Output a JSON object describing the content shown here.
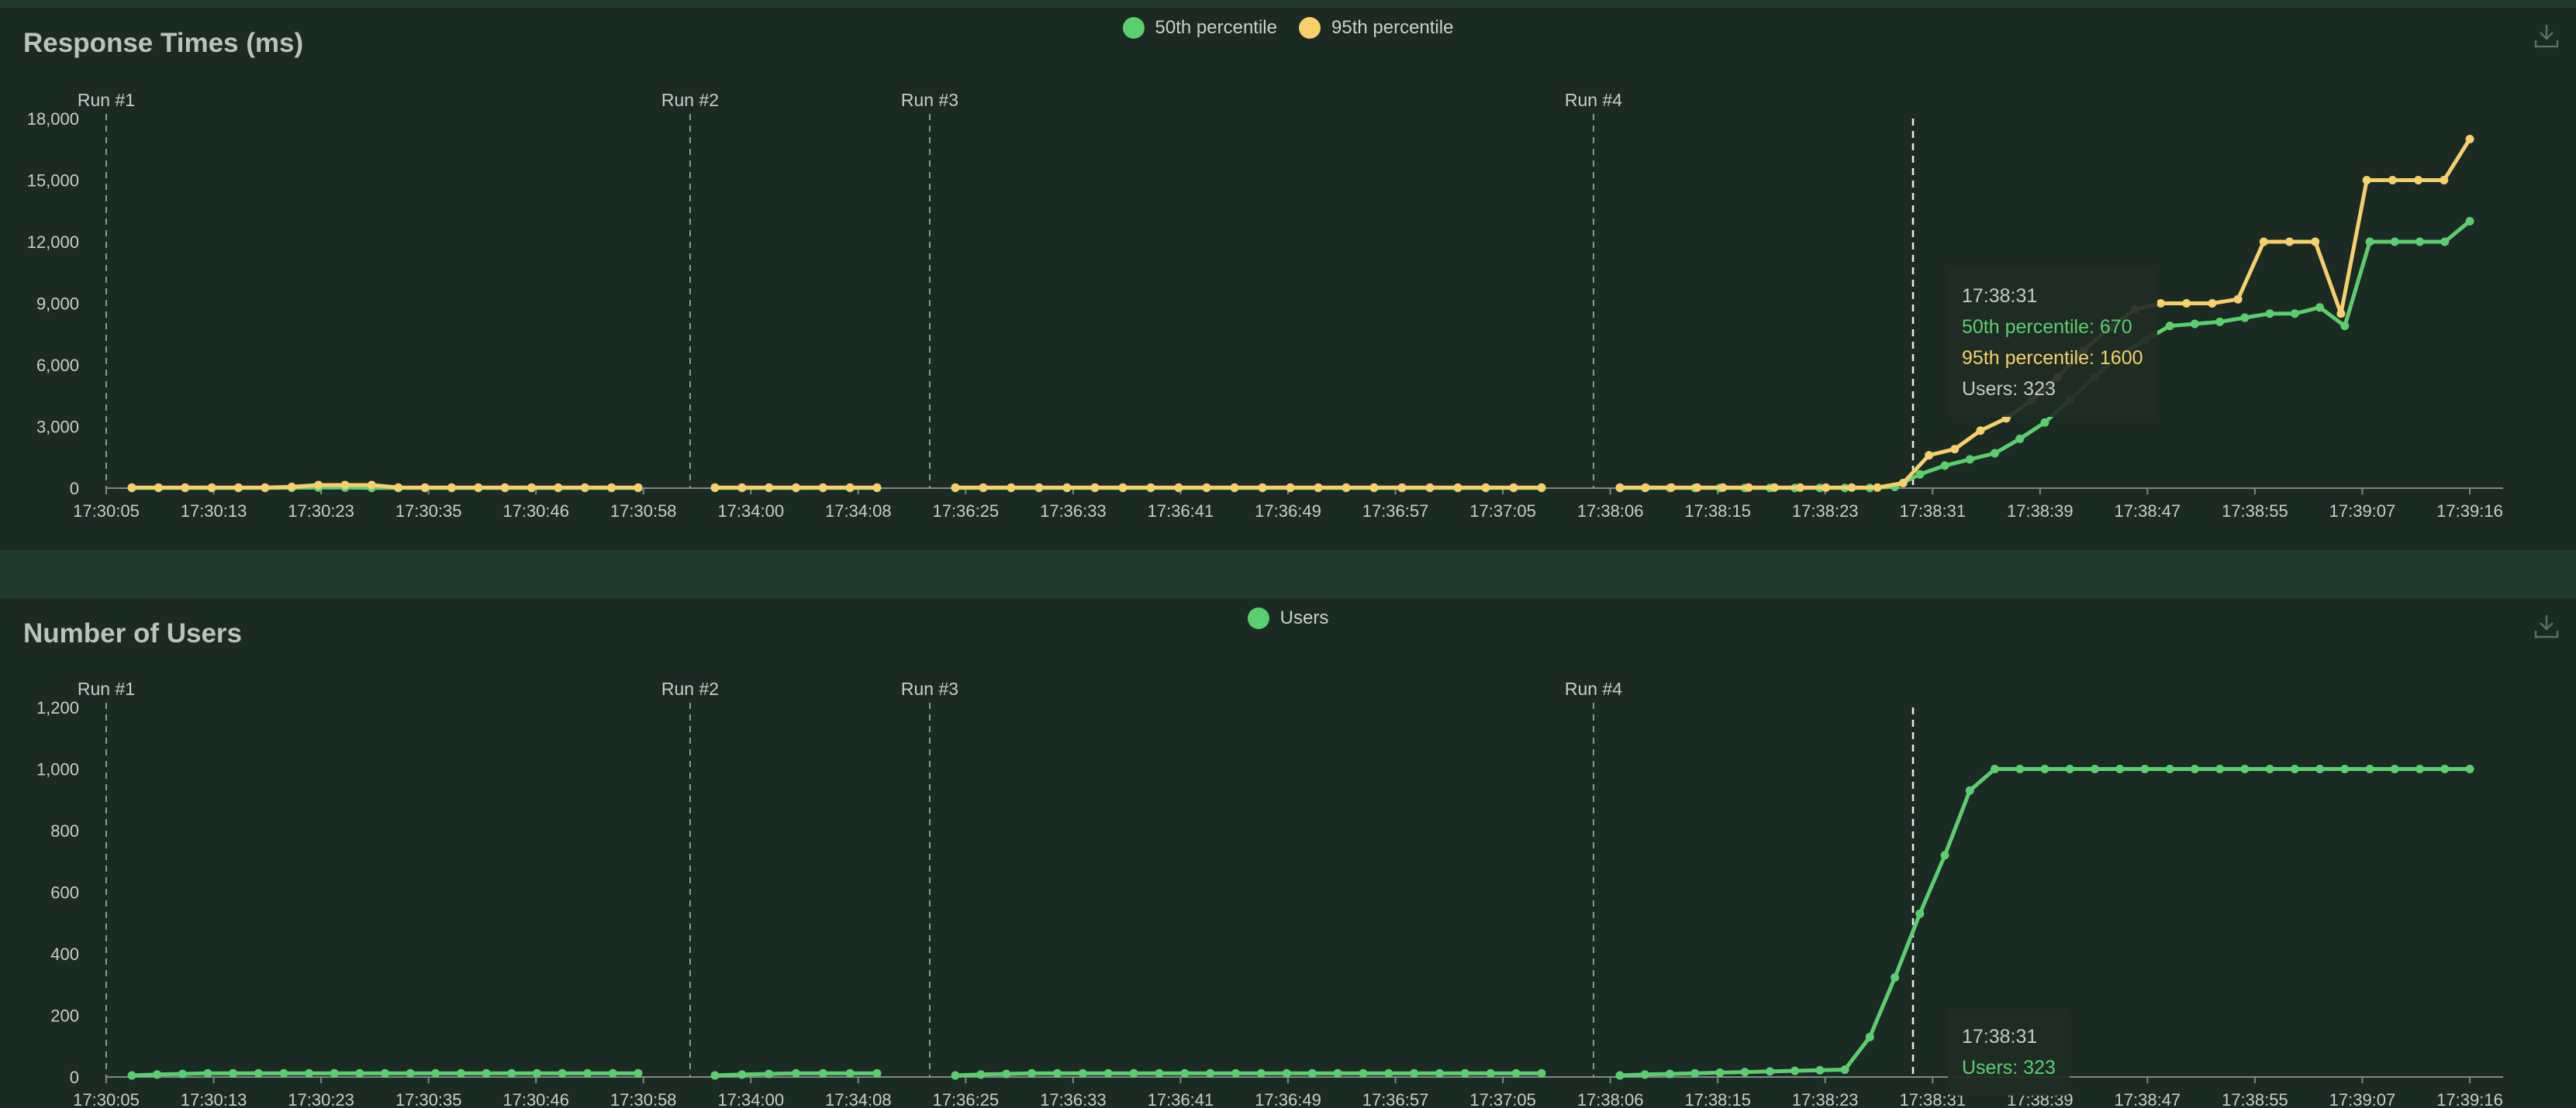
{
  "colors": {
    "p50": "#5bcf6e",
    "p95": "#f7cf6b",
    "users": "#5bcf6e",
    "axis_text": "#c6cec8",
    "divider": "#8b9a90"
  },
  "icons": {
    "download": "download-icon"
  },
  "chart_data": [
    {
      "type": "line",
      "title": "Response Times (ms)",
      "ylim": [
        0,
        18000
      ],
      "yticks": [
        "0",
        "3,000",
        "6,000",
        "9,000",
        "12,000",
        "15,000",
        "18,000"
      ],
      "ytick_values": [
        0,
        3000,
        6000,
        9000,
        12000,
        15000,
        18000
      ],
      "xtick_labels": [
        "17:30:05",
        "17:30:13",
        "17:30:23",
        "17:30:35",
        "17:30:46",
        "17:30:58",
        "17:34:00",
        "17:34:08",
        "17:36:25",
        "17:36:33",
        "17:36:41",
        "17:36:49",
        "17:36:57",
        "17:37:05",
        "17:38:06",
        "17:38:15",
        "17:38:23",
        "17:38:31",
        "17:38:39",
        "17:38:47",
        "17:38:55",
        "17:39:07",
        "17:39:16"
      ],
      "legend_position": "top-center",
      "runs": [
        "Run #1",
        "Run #2",
        "Run #3",
        "Run #4"
      ],
      "series": [
        {
          "name": "50th percentile",
          "segments": [
            [
              10,
              10,
              10,
              10,
              10,
              10,
              20,
              30,
              30,
              10,
              10,
              10,
              10,
              10,
              10,
              10,
              10,
              10,
              10,
              10
            ],
            [
              10,
              10,
              10,
              10,
              10,
              10,
              10
            ],
            [
              10,
              10,
              10,
              10,
              10,
              10,
              10,
              10,
              10,
              10,
              10,
              10,
              10,
              10,
              10,
              10,
              10,
              10,
              10,
              10,
              10,
              10
            ],
            [
              10,
              10,
              10,
              10,
              10,
              10,
              10,
              10,
              10,
              10,
              10,
              60,
              670,
              1100,
              1400,
              1700,
              2400,
              3200,
              4300,
              5400,
              6500,
              7200,
              7900,
              8000,
              8100,
              8300,
              8500,
              8500,
              8800,
              7900,
              12000,
              12000,
              12000,
              12000,
              13000
            ]
          ]
        },
        {
          "name": "95th percentile",
          "segments": [
            [
              30,
              30,
              30,
              30,
              30,
              30,
              60,
              150,
              150,
              150,
              30,
              30,
              30,
              30,
              30,
              30,
              30,
              30,
              30,
              30
            ],
            [
              30,
              30,
              30,
              30,
              30,
              30,
              30
            ],
            [
              30,
              30,
              30,
              30,
              30,
              30,
              30,
              30,
              30,
              30,
              30,
              30,
              30,
              30,
              30,
              30,
              30,
              30,
              30,
              30,
              30,
              30
            ],
            [
              30,
              30,
              30,
              30,
              30,
              30,
              30,
              30,
              30,
              30,
              30,
              250,
              1600,
              1900,
              2800,
              3400,
              4300,
              5400,
              6700,
              7800,
              8700,
              9000,
              9000,
              9000,
              9200,
              12000,
              12000,
              12000,
              8500,
              15000,
              15000,
              15000,
              15000,
              17000
            ]
          ]
        }
      ],
      "tooltip": {
        "time": "17:38:31",
        "lines": [
          "50th percentile: 670",
          "95th percentile: 1600",
          "Users: 323"
        ]
      }
    },
    {
      "type": "line",
      "title": "Number of Users",
      "ylim": [
        0,
        1200
      ],
      "yticks": [
        "0",
        "200",
        "400",
        "600",
        "800",
        "1,000",
        "1,200"
      ],
      "ytick_values": [
        0,
        200,
        400,
        600,
        800,
        1000,
        1200
      ],
      "xtick_labels": [
        "17:30:05",
        "17:30:13",
        "17:30:23",
        "17:30:35",
        "17:30:46",
        "17:30:58",
        "17:34:00",
        "17:34:08",
        "17:36:25",
        "17:36:33",
        "17:36:41",
        "17:36:49",
        "17:36:57",
        "17:37:05",
        "17:38:06",
        "17:38:15",
        "17:38:23",
        "17:38:31",
        "17:38:39",
        "17:38:47",
        "17:38:55",
        "17:39:07",
        "17:39:16"
      ],
      "legend_position": "top-center",
      "runs": [
        "Run #1",
        "Run #2",
        "Run #3",
        "Run #4"
      ],
      "series": [
        {
          "name": "Users",
          "segments": [
            [
              5,
              8,
              10,
              12,
              12,
              12,
              12,
              12,
              12,
              12,
              12,
              12,
              12,
              12,
              12,
              12,
              12,
              12,
              12,
              12,
              12
            ],
            [
              5,
              8,
              10,
              12,
              12,
              12,
              12
            ],
            [
              5,
              8,
              10,
              12,
              12,
              12,
              12,
              12,
              12,
              12,
              12,
              12,
              12,
              12,
              12,
              12,
              12,
              12,
              12,
              12,
              12,
              12,
              12,
              12
            ],
            [
              5,
              8,
              10,
              12,
              14,
              16,
              18,
              20,
              22,
              24,
              130,
              323,
              530,
              720,
              930,
              1000,
              1000,
              1000,
              1000,
              1000,
              1000,
              1000,
              1000,
              1000,
              1000,
              1000,
              1000,
              1000,
              1000,
              1000,
              1000,
              1000,
              1000,
              1000,
              1000
            ]
          ]
        }
      ],
      "tooltip": {
        "time": "17:38:31",
        "lines": [
          "Users: 323"
        ]
      }
    }
  ]
}
